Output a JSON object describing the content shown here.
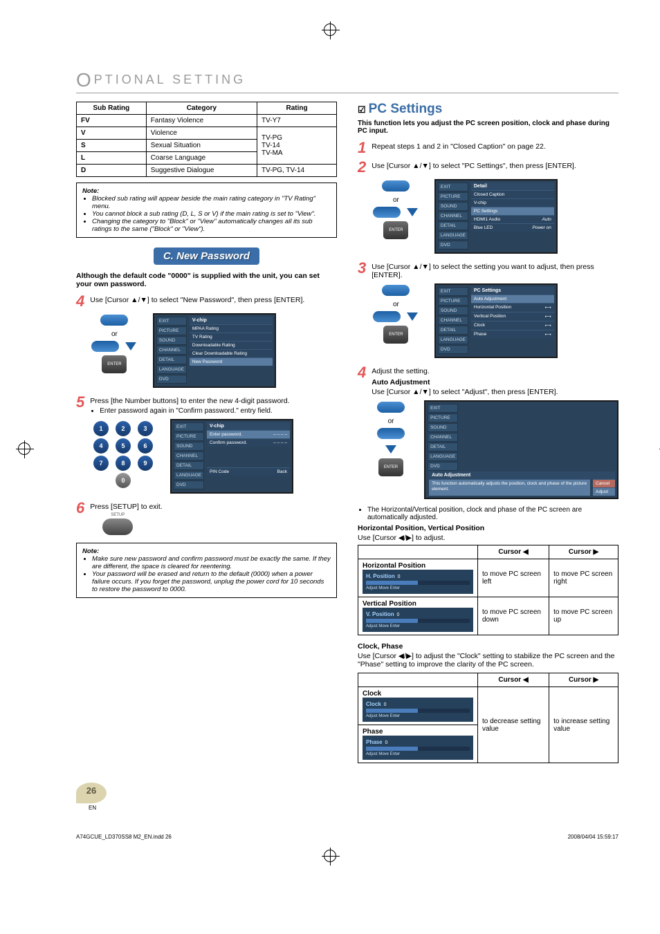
{
  "page": {
    "section_title_prefix": "O",
    "section_title_rest": "PTIONAL SETTING",
    "number": "26",
    "en": "EN",
    "footer_left": "A74GCUE_LD370SS8 M2_EN.indd   26",
    "footer_right": "2008/04/04   15:59:17"
  },
  "rating_table": {
    "headers": [
      "Sub Rating",
      "Category",
      "Rating"
    ],
    "rows": [
      {
        "sub": "FV",
        "cat": "Fantasy Violence",
        "rating": "TV-Y7"
      },
      {
        "sub": "V",
        "cat": "Violence",
        "rating": "TV-PG\nTV-14\nTV-MA"
      },
      {
        "sub": "S",
        "cat": "Sexual Situation",
        "rating": ""
      },
      {
        "sub": "L",
        "cat": "Coarse Language",
        "rating": ""
      },
      {
        "sub": "D",
        "cat": "Suggestive Dialogue",
        "rating": "TV-PG, TV-14"
      }
    ]
  },
  "note1": {
    "head": "Note:",
    "items": [
      "Blocked sub rating will appear beside the main rating category in \"TV Rating\" menu.",
      "You cannot block a sub rating (D, L, S or V) if the main rating is set to \"View\".",
      "Changing the category to \"Block\" or \"View\" automatically changes all its sub ratings to the same (\"Block\" or \"View\")."
    ]
  },
  "newpass": {
    "heading": "C.  New Password",
    "intro": "Although the default code \"0000\" is supplied with the unit, you can set your own password.",
    "step4": "Use [Cursor ▲/▼] to select \"New Password\", then press [ENTER].",
    "menu4": {
      "side": [
        "EXIT",
        "PICTURE",
        "SOUND",
        "CHANNEL",
        "DETAIL",
        "LANGUAGE",
        "DVD"
      ],
      "hdr": "V-chip",
      "rows": [
        "MPAA Rating",
        "TV Rating",
        "Downloadable Rating",
        "Clear Downloadable Rating",
        "New Password"
      ]
    },
    "step5": "Press [the Number buttons] to enter the new 4-digit password.",
    "step5b": "Enter password again in \"Confirm password.\" entry field.",
    "menu5": {
      "hdr": "V-chip",
      "r1": "Enter password.",
      "r2": "Confirm password.",
      "pin": "PIN Code",
      "back": "Back"
    },
    "step6": "Press [SETUP] to exit.",
    "setup_label": "SETUP"
  },
  "note2": {
    "head": "Note:",
    "items": [
      "Make sure new password and confirm password must be exactly the same. If they are different, the space is cleared for reentering.",
      "Your password will be erased and return to the default (0000) when a power failure occurs. If you forget the password, unplug the power cord for 10 seconds to restore the password to 0000."
    ]
  },
  "pc": {
    "title": "PC Settings",
    "desc": "This function lets you adjust the PC screen position, clock and phase during PC input.",
    "step1": "Repeat steps 1 and 2 in \"Closed Caption\" on page 22.",
    "step2": "Use [Cursor ▲/▼] to select \"PC Settings\", then press [ENTER].",
    "menu2": {
      "side": [
        "EXIT",
        "PICTURE",
        "SOUND",
        "CHANNEL",
        "DETAIL",
        "LANGUAGE",
        "DVD"
      ],
      "hdr": "Detail",
      "rows": [
        {
          "l": "Closed Caption",
          "r": ""
        },
        {
          "l": "V-chip",
          "r": ""
        },
        {
          "l": "PC Settings",
          "r": "",
          "sel": true
        },
        {
          "l": "HDMI1 Audio",
          "r": "Auto"
        },
        {
          "l": "Blue LED",
          "r": "Power on"
        }
      ]
    },
    "step3": "Use [Cursor ▲/▼] to select the setting you want to adjust, then press [ENTER].",
    "menu3": {
      "hdr": "PC Settings",
      "rows": [
        {
          "l": "Auto Adjustment",
          "r": "",
          "sel": true
        },
        {
          "l": "Horizontal Position",
          "r": "⟷"
        },
        {
          "l": "Vertical Position",
          "r": "⟷"
        },
        {
          "l": "Clock",
          "r": "⟷"
        },
        {
          "l": "Phase",
          "r": "⟷"
        }
      ]
    },
    "step4_lead": "Adjust the setting.",
    "auto_head": "Auto Adjustment",
    "auto_txt": "Use [Cursor ▲/▼] to select \"Adjust\", then press [ENTER].",
    "menu4": {
      "hdr": "Auto Adjustment",
      "txt": "This function automatically adjusts the position, clock and phase of the picture element.",
      "c": "Cancel",
      "a": "Adjust"
    },
    "auto_bullet": "The Horizontal/Vertical position, clock and phase of the PC screen are automatically adjusted.",
    "hv_head": "Horizontal Position, Vertical Position",
    "hv_txt": "Use [Cursor ◀/▶] to adjust.",
    "cp_head": "Clock, Phase",
    "cp_txt": "Use [Cursor ◀/▶] to adjust the \"Clock\" setting to stabilize the PC screen and the \"Phase\" setting to improve the clarity of the PC screen."
  },
  "hv_table": {
    "h1": "Cursor ◀",
    "h2": "Cursor ▶",
    "r1_label": "Horizontal Position",
    "r1_panel": "H. Position",
    "r1_l": "to move PC screen left",
    "r1_r": "to move PC screen right",
    "r2_label": "Vertical Position",
    "r2_panel": "V. Position",
    "r2_l": "to move PC screen down",
    "r2_r": "to move PC screen up",
    "mini": "Adjust        Move        Enter"
  },
  "cp_table": {
    "h1": "Cursor ◀",
    "h2": "Cursor ▶",
    "r1_label": "Clock",
    "r1_panel": "Clock",
    "r2_label": "Phase",
    "r2_panel": "Phase",
    "l": "to decrease setting value",
    "r": "to increase setting value",
    "mini": "Adjust        Move        Enter"
  },
  "common": {
    "or": "or",
    "enter": "ENTER"
  }
}
